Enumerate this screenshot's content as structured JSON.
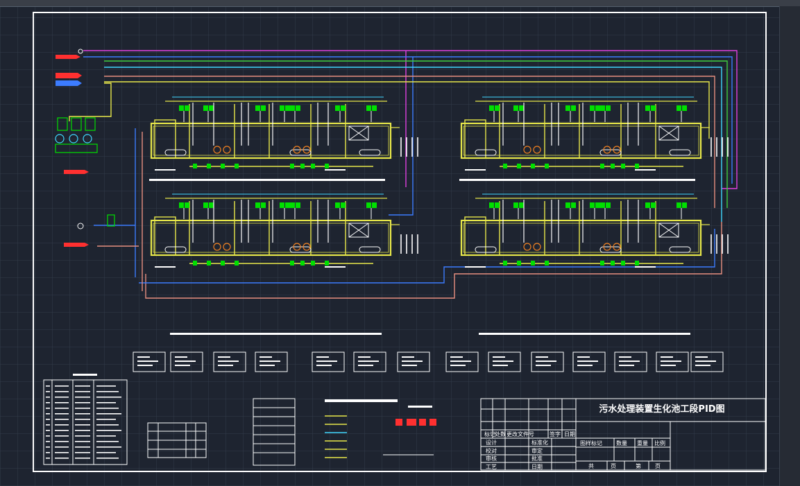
{
  "drawing": {
    "title": "污水处理装置生化池工段PID图"
  },
  "title_block": {
    "header_row": [
      "标记",
      "处数",
      "更改文件号",
      "签字",
      "日期"
    ],
    "left_rows": [
      [
        "设计",
        "标准化"
      ],
      [
        "校对",
        "审定"
      ],
      [
        "审核",
        "批准"
      ],
      [
        "工艺",
        "日期"
      ]
    ],
    "right_header": [
      "图样标记",
      "数量",
      "重量",
      "比例"
    ],
    "sheet_row": [
      "共",
      "页",
      "第",
      "页"
    ]
  },
  "colors": {
    "background": "#1e2430",
    "grid": "#3a4656",
    "frame": "#ffffff",
    "tank": "#e8e84a",
    "equipment": "#00e000",
    "pipe_yellow": "#e8e84a",
    "pipe_cyan": "#40d8ff",
    "pipe_blue": "#3c7cff",
    "pipe_magenta": "#e040e0",
    "pipe_green": "#40d040",
    "pipe_salmon": "#e89080",
    "pipe_red": "#ff3030"
  }
}
